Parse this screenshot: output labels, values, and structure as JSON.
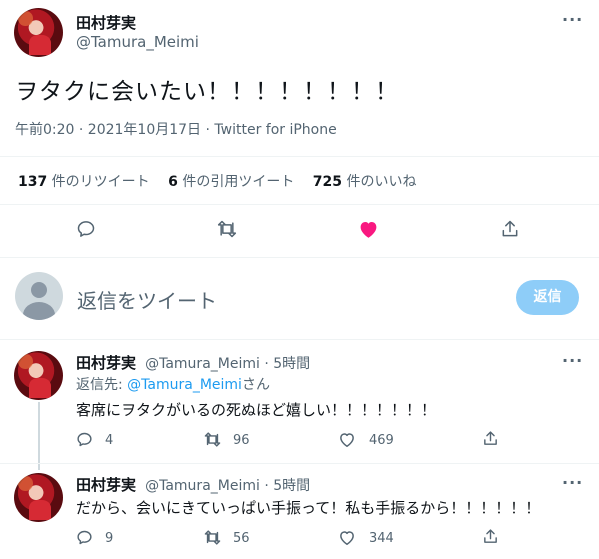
{
  "main_tweet": {
    "author_name": "田村芽実",
    "author_handle": "@Tamura_Meimi",
    "text": "ヲタクに会いたい！！！！！！！！",
    "timestamp": "午前0:20 · 2021年10月17日 · ",
    "source": "Twitter for iPhone",
    "stats": {
      "retweets_count": "137",
      "retweets_label": " 件のリツイート",
      "quotes_count": "6",
      "quotes_label": " 件の引用ツイート",
      "likes_count": "725",
      "likes_label": " 件のいいね"
    },
    "like_color": "#f91880"
  },
  "compose": {
    "placeholder": "返信をツイート",
    "reply_button": "返信",
    "reply_button_color": "#8ecdf8"
  },
  "replies": [
    {
      "author_name": "田村芽実",
      "meta": "@Tamura_Meimi · 5時間",
      "replying_prefix": "返信先: ",
      "replying_handle": "@Tamura_Meimi",
      "replying_suffix": "さん",
      "text": "客席にヲタクがいるの死ぬほど嬉しい！！！！！！！",
      "reply_count": "4",
      "retweet_count": "96",
      "like_count": "469"
    },
    {
      "author_name": "田村芽実",
      "meta": "@Tamura_Meimi · 5時間",
      "text": "だから、会いにきていっぱい手振って！私も手振るから！！！！！！",
      "reply_count": "9",
      "retweet_count": "56",
      "like_count": "344"
    }
  ],
  "accent_color": "#1d9bf0"
}
